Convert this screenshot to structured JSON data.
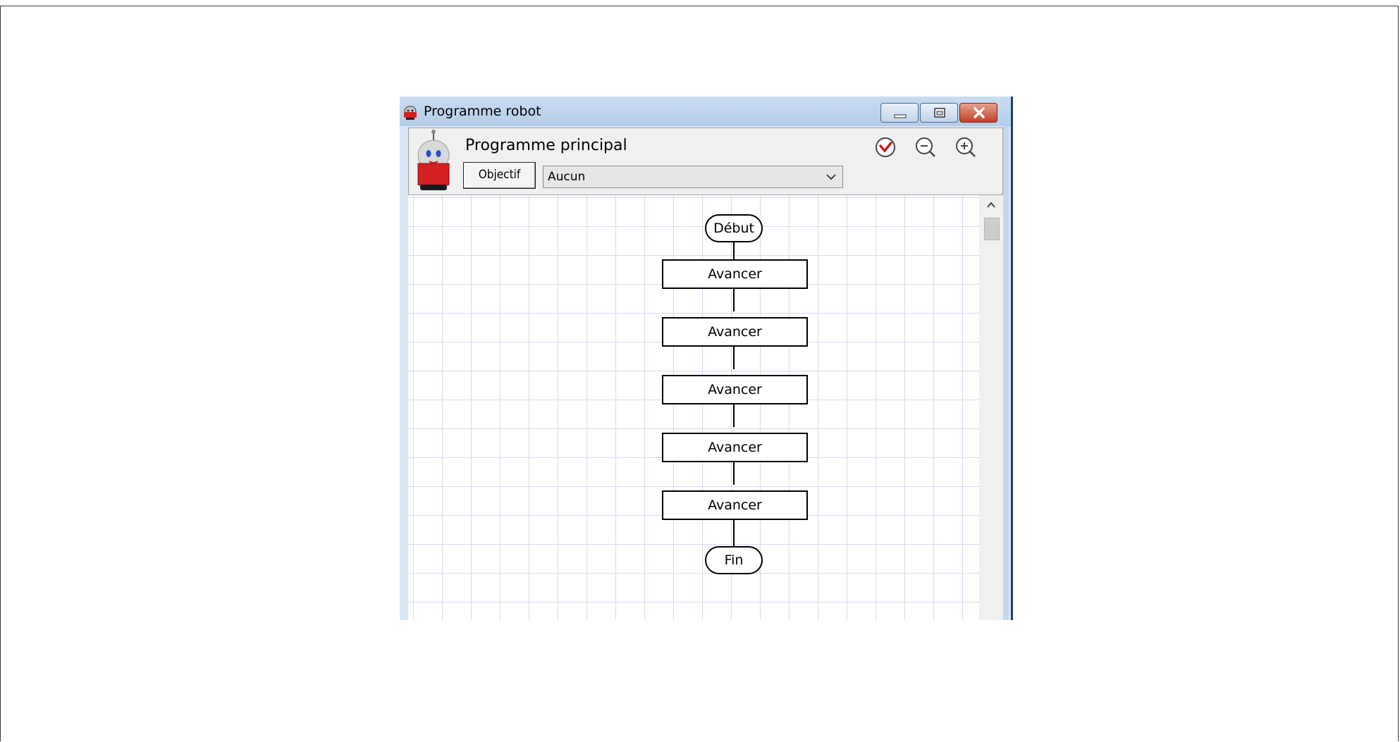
{
  "window": {
    "title": "Programme robot",
    "buttons": [
      "minimize",
      "maximize",
      "close"
    ]
  },
  "header": {
    "title": "Programme principal",
    "objectif_label": "Objectif",
    "objective_select": {
      "selected": "Aucun"
    },
    "icons": [
      "run-check-icon",
      "zoom-out-icon",
      "zoom-in-icon"
    ]
  },
  "flowchart": {
    "start": "Début",
    "steps": [
      "Avancer",
      "Avancer",
      "Avancer",
      "Avancer",
      "Avancer"
    ],
    "end": "Fin"
  },
  "colors": {
    "titlebar": "#b4cde8",
    "close_button": "#c0412a",
    "grid_lines": "#d8d8f4",
    "robot_body": "#d42020"
  }
}
